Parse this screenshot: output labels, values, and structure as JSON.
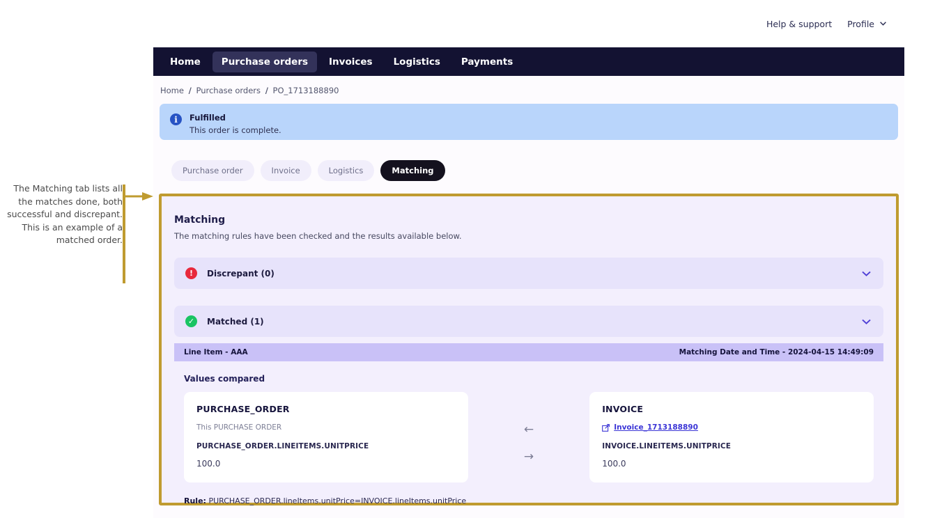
{
  "annotation": {
    "text": "The Matching tab lists all the matches done, both successful and discrepant.\nThis is an example of a matched order.",
    "arrow_icon": "right-arrow",
    "color": "#bf9b30"
  },
  "topbar": {
    "help_label": "Help & support",
    "profile_label": "Profile",
    "profile_chevron_icon": "chevron-down-icon"
  },
  "nav": {
    "items": [
      {
        "label": "Home",
        "active": false
      },
      {
        "label": "Purchase orders",
        "active": true
      },
      {
        "label": "Invoices",
        "active": false
      },
      {
        "label": "Logistics",
        "active": false
      },
      {
        "label": "Payments",
        "active": false
      }
    ],
    "background": "#131232",
    "active_background": "#33325a"
  },
  "breadcrumb": {
    "items": [
      "Home",
      "Purchase orders",
      "PO_1713188890"
    ],
    "separator": "/"
  },
  "alert": {
    "icon": "info-icon",
    "title": "Fulfilled",
    "body": "This order is complete.",
    "background": "#b9d5fb",
    "icon_color": "#2753c4"
  },
  "tabs": [
    {
      "label": "Purchase order",
      "active": false
    },
    {
      "label": "Invoice",
      "active": false
    },
    {
      "label": "Logistics",
      "active": false
    },
    {
      "label": "Matching",
      "active": true
    }
  ],
  "matching": {
    "title": "Matching",
    "subtitle": "The matching rules have been checked and the results available below.",
    "sections": [
      {
        "label": "Discrepant (0)",
        "status_icon": "error-exclamation-icon",
        "status_color": "#e8293c",
        "chevron_icon": "chevron-down-icon",
        "expanded": false
      },
      {
        "label": "Matched (1)",
        "status_icon": "success-check-icon",
        "status_color": "#19c463",
        "chevron_icon": "chevron-down-icon",
        "expanded": true
      }
    ],
    "matched_detail": {
      "line_item_label": "Line Item - AAA",
      "matching_datetime_label": "Matching Date and Time - 2024-04-15 14:49:09",
      "values_compared_label": "Values compared",
      "left_card": {
        "title": "PURCHASE_ORDER",
        "description": "This PURCHASE ORDER",
        "field": "PURCHASE_ORDER.LINEITEMS.UNITPRICE",
        "value": "100.0"
      },
      "right_card": {
        "title": "INVOICE",
        "link_icon": "external-link-icon",
        "link_label": "Invoice_1713188890",
        "field": "INVOICE.LINEITEMS.UNITPRICE",
        "value": "100.0"
      },
      "arrows": {
        "left": "←",
        "right": "→"
      },
      "rule_label": "Rule:",
      "rule_text": "PURCHASE_ORDER.lineItems.unitPrice=INVOICE.lineItems.unitPrice"
    }
  }
}
